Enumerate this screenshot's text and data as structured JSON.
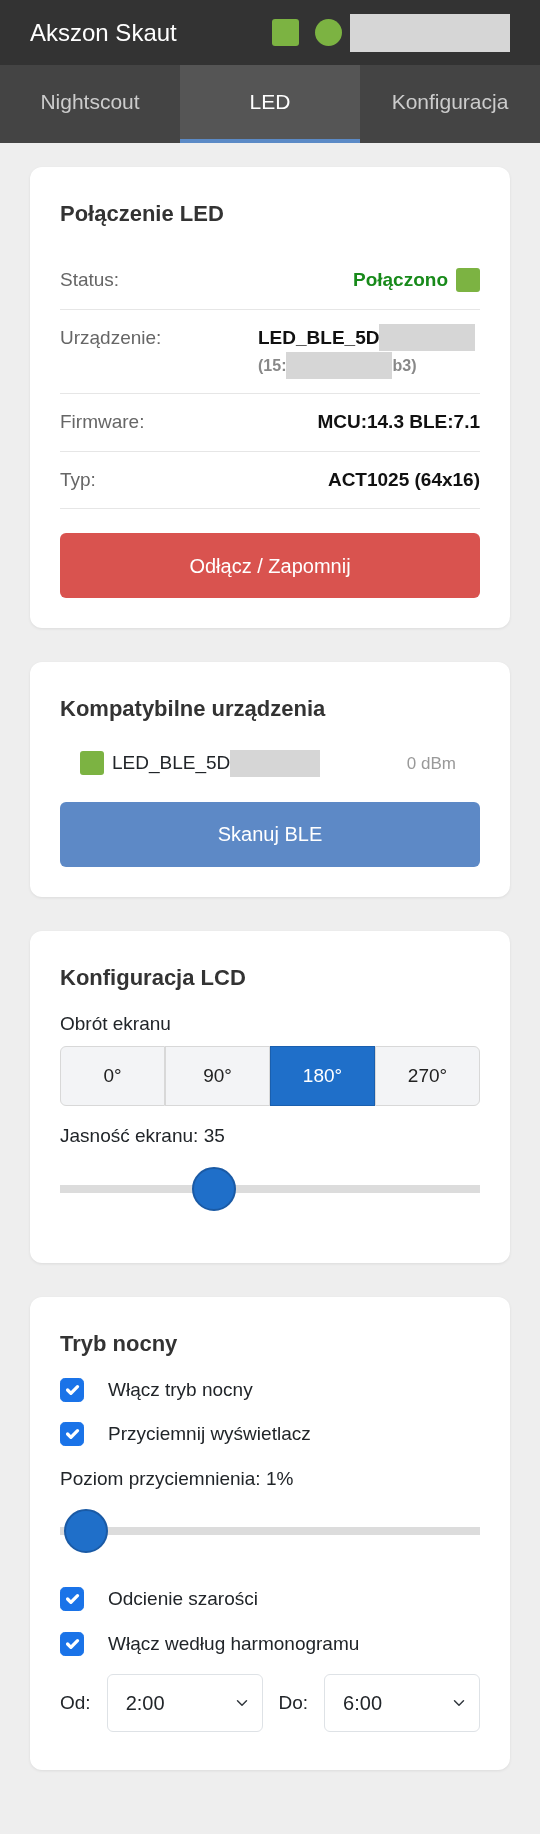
{
  "header": {
    "title": "Akszon Skaut"
  },
  "tabs": [
    {
      "label": "Nightscout",
      "selected": false
    },
    {
      "label": "LED",
      "selected": true
    },
    {
      "label": "Konfiguracja",
      "selected": false
    }
  ],
  "connection": {
    "title": "Połączenie LED",
    "rows": [
      {
        "kind": "status",
        "label": "Status:",
        "value": "Połączono"
      },
      {
        "kind": "device",
        "label": "Urządzenie:",
        "value": "LED_BLE_5D",
        "address_start": "(15:",
        "address_end": "b3)"
      },
      {
        "kind": "plain",
        "label": "Firmware:",
        "value": "MCU:14.3 BLE:7.1"
      },
      {
        "kind": "plain",
        "label": "Typ:",
        "value": "ACT1025 (64x16)"
      }
    ],
    "button": "Odłącz / Zapomnij"
  },
  "compatible": {
    "title": "Kompatybilne urządzenia",
    "devices": [
      {
        "name": "LED_BLE_5D",
        "signal": "0 dBm"
      }
    ],
    "button": "Skanuj BLE"
  },
  "lcd": {
    "title": "Konfiguracja LCD",
    "rotation_label": "Obrót ekranu",
    "rotations": [
      {
        "label": "0°",
        "selected": false
      },
      {
        "label": "90°",
        "selected": false
      },
      {
        "label": "180°",
        "selected": true
      },
      {
        "label": "270°",
        "selected": false
      }
    ],
    "brightness_label": "Jasność ekranu: 35",
    "brightness": {
      "level": 0.35
    }
  },
  "night": {
    "title": "Tryb nocny",
    "items": [
      {
        "kind": "checkbox",
        "label": "Włącz tryb nocny",
        "checked": true
      },
      {
        "kind": "checkbox",
        "label": "Przyciemnij wyświetlacz",
        "checked": true
      },
      {
        "kind": "slider",
        "label": "Poziom przyciemnienia: 1%",
        "level": 0.01
      },
      {
        "kind": "checkbox",
        "label": "Odcienie szarości",
        "checked": true
      },
      {
        "kind": "checkbox",
        "label": "Włącz według harmonogramu",
        "checked": true
      }
    ],
    "from_label": "Od:",
    "from": "2:00",
    "to_label": "Do:",
    "to": "6:00"
  }
}
